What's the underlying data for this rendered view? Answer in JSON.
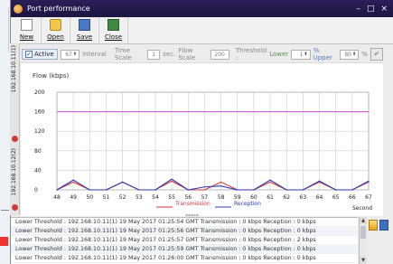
{
  "window": {
    "title": "Port performance",
    "controls": [
      "–",
      "□",
      "×"
    ]
  },
  "toolbar": {
    "new_label": "New",
    "open_label": "Open",
    "save_label": "Save",
    "close_label": "Close"
  },
  "controls": {
    "active_label": "Active",
    "interval_value": "67",
    "interval_label": "Interval",
    "time_scale_label": "Time Scale",
    "time_scale_value": "1",
    "sec_label": "sec.",
    "flow_scale_label": "Flow Scale",
    "flow_scale_value": "200",
    "threshold_label": "Threshold :",
    "lower_label": "Lower",
    "lower_value": "1",
    "percent_upper_label": "% Upper",
    "upper_value": "80",
    "percent_label": "%"
  },
  "side_tabs": [
    {
      "label": "192.168.10.11(1)"
    },
    {
      "label": "192.168.10.12(2)"
    }
  ],
  "divider": "*****",
  "chart_data": {
    "type": "line",
    "ylabel": "Flow (kbps)",
    "xlabel": "Second",
    "ylim": [
      0,
      200
    ],
    "yticks": [
      0,
      40,
      80,
      120,
      160,
      200
    ],
    "x": [
      48,
      49,
      50,
      51,
      52,
      53,
      54,
      55,
      56,
      57,
      58,
      59,
      60,
      61,
      62,
      63,
      64,
      65,
      66,
      67
    ],
    "threshold_line": 160,
    "series": [
      {
        "name": "Transmission",
        "color": "#d63a3a",
        "values": [
          0,
          16,
          0,
          0,
          16,
          0,
          0,
          18,
          0,
          0,
          16,
          0,
          0,
          16,
          0,
          0,
          16,
          0,
          0,
          16
        ]
      },
      {
        "name": "Reception",
        "color": "#2b3ab8",
        "values": [
          0,
          20,
          0,
          0,
          16,
          0,
          0,
          22,
          0,
          6,
          8,
          0,
          0,
          20,
          0,
          0,
          18,
          0,
          0,
          18
        ]
      }
    ],
    "colors": {
      "threshold": "#d64ad6",
      "grid": "#cccccc"
    },
    "legend_placement": "bottom-center"
  },
  "log": {
    "rows": [
      "Lower Threshold : 192.168.10.11(1) 19 May 2017 01:25:54 GMT Transmission : 0 kbps Reception : 0 kbps",
      "Lower Threshold : 192.168.10.11(1) 19 May 2017 01:25:56 GMT Transmission : 0 kbps Reception : 0 kbps",
      "Lower Threshold : 192.168.10.11(1) 19 May 2017 01:25:57 GMT Transmission : 0 kbps Reception : 2 kbps",
      "Lower Threshold : 192.168.10.11(1) 19 May 2017 01:25:59 GMT Transmission : 0 kbps Reception : 0 kbps",
      "Lower Threshold : 192.168.10.11(1) 19 May 2017 01:26:00 GMT Transmission : 0 kbps Reception : 0 kbps"
    ]
  }
}
